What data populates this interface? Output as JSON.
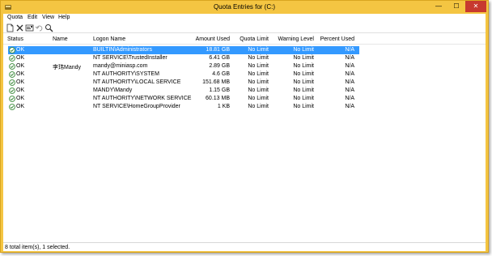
{
  "window": {
    "title": "Quota Entries for  (C:)",
    "min_glyph": "—",
    "max_glyph": "☐",
    "close_glyph": "✕"
  },
  "menu": [
    "Quota",
    "Edit",
    "View",
    "Help"
  ],
  "toolbar": {
    "icons": [
      "new-entry-icon",
      "delete-icon",
      "properties-icon",
      "undo-icon",
      "find-icon"
    ]
  },
  "columns": [
    "Status",
    "Name",
    "Logon Name",
    "Amount Used",
    "Quota Limit",
    "Warning Level",
    "Percent Used"
  ],
  "rows": [
    {
      "status": "OK",
      "name": "",
      "logon": "BUILTIN\\Administrators",
      "used": "18.81 GB",
      "limit": "No Limit",
      "warn": "No Limit",
      "pct": "N/A",
      "selected": true
    },
    {
      "status": "OK",
      "name": "",
      "logon": "NT SERVICE\\TrustedInstaller",
      "used": "6.41 GB",
      "limit": "No Limit",
      "warn": "No Limit",
      "pct": "N/A",
      "selected": false
    },
    {
      "status": "OK",
      "name": "李玮Mandy",
      "logon": "mandy@miniasp.com",
      "used": "2.89 GB",
      "limit": "No Limit",
      "warn": "No Limit",
      "pct": "N/A",
      "selected": false
    },
    {
      "status": "OK",
      "name": "",
      "logon": "NT AUTHORITY\\SYSTEM",
      "used": "4.6 GB",
      "limit": "No Limit",
      "warn": "No Limit",
      "pct": "N/A",
      "selected": false
    },
    {
      "status": "OK",
      "name": "",
      "logon": "NT AUTHORITY\\LOCAL SERVICE",
      "used": "151.68 MB",
      "limit": "No Limit",
      "warn": "No Limit",
      "pct": "N/A",
      "selected": false
    },
    {
      "status": "OK",
      "name": "",
      "logon": "MANDY\\Mandy",
      "used": "1.15 GB",
      "limit": "No Limit",
      "warn": "No Limit",
      "pct": "N/A",
      "selected": false
    },
    {
      "status": "OK",
      "name": "",
      "logon": "NT AUTHORITY\\NETWORK SERVICE",
      "used": "60.13 MB",
      "limit": "No Limit",
      "warn": "No Limit",
      "pct": "N/A",
      "selected": false
    },
    {
      "status": "OK",
      "name": "",
      "logon": "NT SERVICE\\HomeGroupProvider",
      "used": "1 KB",
      "limit": "No Limit",
      "warn": "No Limit",
      "pct": "N/A",
      "selected": false
    }
  ],
  "status_bar": "8 total item(s), 1 selected.",
  "colors": {
    "titlebar": "#f4c542",
    "selection": "#3399ff",
    "close_button": "#c7392f",
    "status_ok_icon": "#3a8a3a"
  }
}
